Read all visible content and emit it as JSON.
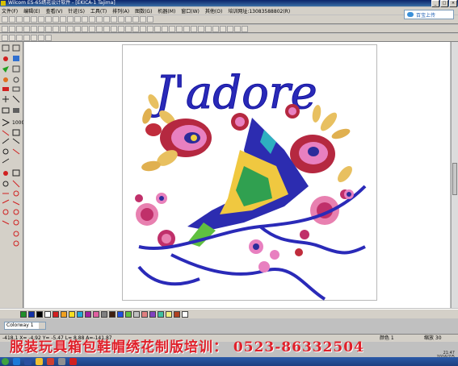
{
  "window": {
    "title": "Wilcom ES-65绣花设计软件 - [EKICA-1          Tajima]"
  },
  "menu": {
    "items": [
      "文件(F)",
      "编辑(E)",
      "查看(V)",
      "针迹(S)",
      "工具(T)",
      "排列(A)",
      "图数(G)",
      "机器(M)",
      "窗口(W)",
      "其他(O)",
      "培训网址:13083588802(R)"
    ]
  },
  "toolbar": {
    "upload_label": "百宝上传"
  },
  "design": {
    "text": "J'adore"
  },
  "palette": {
    "colors": [
      "#1f8f2a",
      "#1030a8",
      "#000000",
      "#ffffff",
      "#d22020",
      "#f0a020",
      "#f8e020",
      "#20a8d8",
      "#a020a0",
      "#e060a0",
      "#808080",
      "#402010",
      "#2050e0",
      "#60c040",
      "#c0c0c0",
      "#e08080",
      "#8040c0",
      "#40c0a0",
      "#f0f080",
      "#b04020",
      "#ffffff"
    ]
  },
  "colorway": {
    "value": "Colorway 1"
  },
  "status": {
    "coords": "-418.1 X=  -4.92 Y=  -5.47 L=   8.88 A=-141.87",
    "color_label": "颜色  1",
    "zoom_label": "缩放  30"
  },
  "watermark": {
    "text": "服装玩具箱包鞋帽绣花制版培训： 0523-86332504"
  },
  "clock": {
    "time": "21:47",
    "date": "2016/7/5"
  }
}
